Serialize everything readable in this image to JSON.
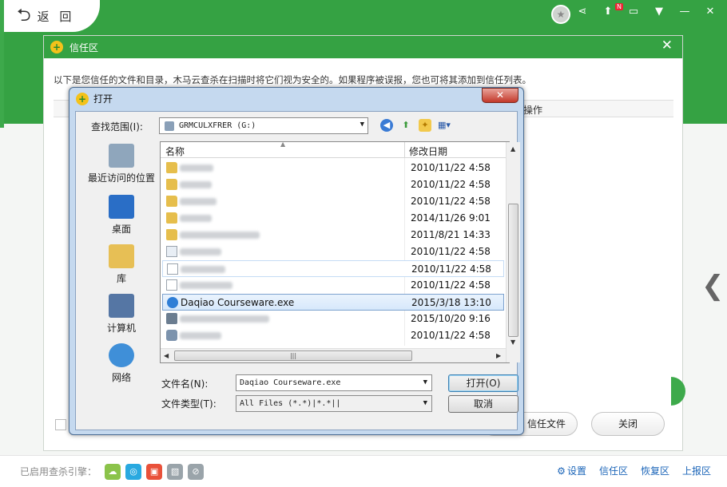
{
  "app": {
    "back_label": "返 回",
    "footer": {
      "engines_label": "已启用查杀引擎：",
      "links": [
        "设置",
        "信任区",
        "恢复区",
        "上报区"
      ]
    }
  },
  "trust_dialog": {
    "title": "信任区",
    "description": "以下是您信任的文件和目录，木马云查杀在扫描时将它们视为安全的。如果程序被误报，您也可将其添加到信任列表。",
    "column_ops": "操作",
    "add_file_button": "信任文件",
    "close_button": "关闭"
  },
  "open_dialog": {
    "title": "打开",
    "lookin_label": "查找范围(I):",
    "lookin_value": "GRMCULXFRER (G:)",
    "places": [
      "最近访问的位置",
      "桌面",
      "库",
      "计算机",
      "网络"
    ],
    "columns": {
      "name": "名称",
      "date": "修改日期"
    },
    "files": [
      {
        "type": "folder",
        "name": "",
        "date": "2010/11/22 4:58"
      },
      {
        "type": "folder",
        "name": "",
        "date": "2010/11/22 4:58"
      },
      {
        "type": "folder",
        "name": "",
        "date": "2010/11/22 4:58"
      },
      {
        "type": "folder",
        "name": "",
        "date": "2014/11/26 9:01"
      },
      {
        "type": "folder",
        "name": "",
        "date": "2011/8/21 14:33"
      },
      {
        "type": "settings",
        "name": "",
        "date": "2010/11/22 4:58"
      },
      {
        "type": "doc",
        "name": "",
        "date": "2010/11/22 4:58"
      },
      {
        "type": "doc",
        "name": "",
        "date": "2010/11/22 4:58"
      },
      {
        "type": "exe",
        "name": "Daqiao Courseware.exe",
        "date": "2015/3/18 13:10"
      },
      {
        "type": "swf",
        "name": "",
        "date": "2015/10/20 9:16"
      },
      {
        "type": "app",
        "name": "",
        "date": "2010/11/22 4:58"
      }
    ],
    "filename_label": "文件名(N):",
    "filename_value": "Daqiao Courseware.exe",
    "filetype_label": "文件类型(T):",
    "filetype_value": "All Files (*.*)|*.*||",
    "open_button": "打开(O)",
    "cancel_button": "取消"
  }
}
